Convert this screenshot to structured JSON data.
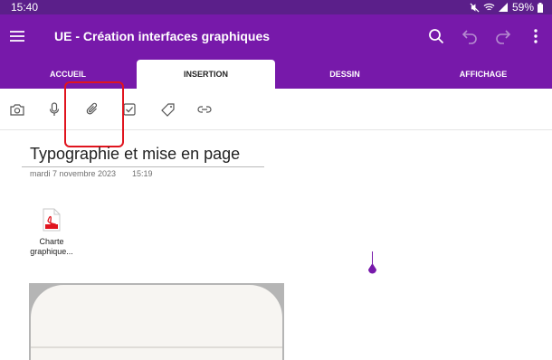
{
  "status_bar": {
    "time": "15:40",
    "battery": "59%"
  },
  "app_bar": {
    "title": "UE - Création interfaces graphiques",
    "icons": [
      "menu-icon",
      "search-icon",
      "undo-icon",
      "redo-icon",
      "more-icon"
    ]
  },
  "tabs": [
    {
      "label": "ACCUEIL",
      "active": false
    },
    {
      "label": "INSERTION",
      "active": true
    },
    {
      "label": "DESSIN",
      "active": false
    },
    {
      "label": "AFFICHAGE",
      "active": false
    }
  ],
  "toolbar": {
    "tools": [
      "camera-icon",
      "microphone-icon",
      "attachment-icon",
      "checkbox-icon",
      "tag-icon",
      "link-icon"
    ],
    "highlighted": "attachment-icon"
  },
  "page": {
    "title": "Typographie et mise en page",
    "date": "mardi 7 novembre 2023",
    "time": "15:19"
  },
  "attachment": {
    "icon": "pdf-file-icon",
    "name_line1": "Charte",
    "name_line2": "graphique..."
  },
  "colors": {
    "accent": "#7719aa",
    "status_bar": "#5b1f8a",
    "highlight": "#e0141e"
  }
}
